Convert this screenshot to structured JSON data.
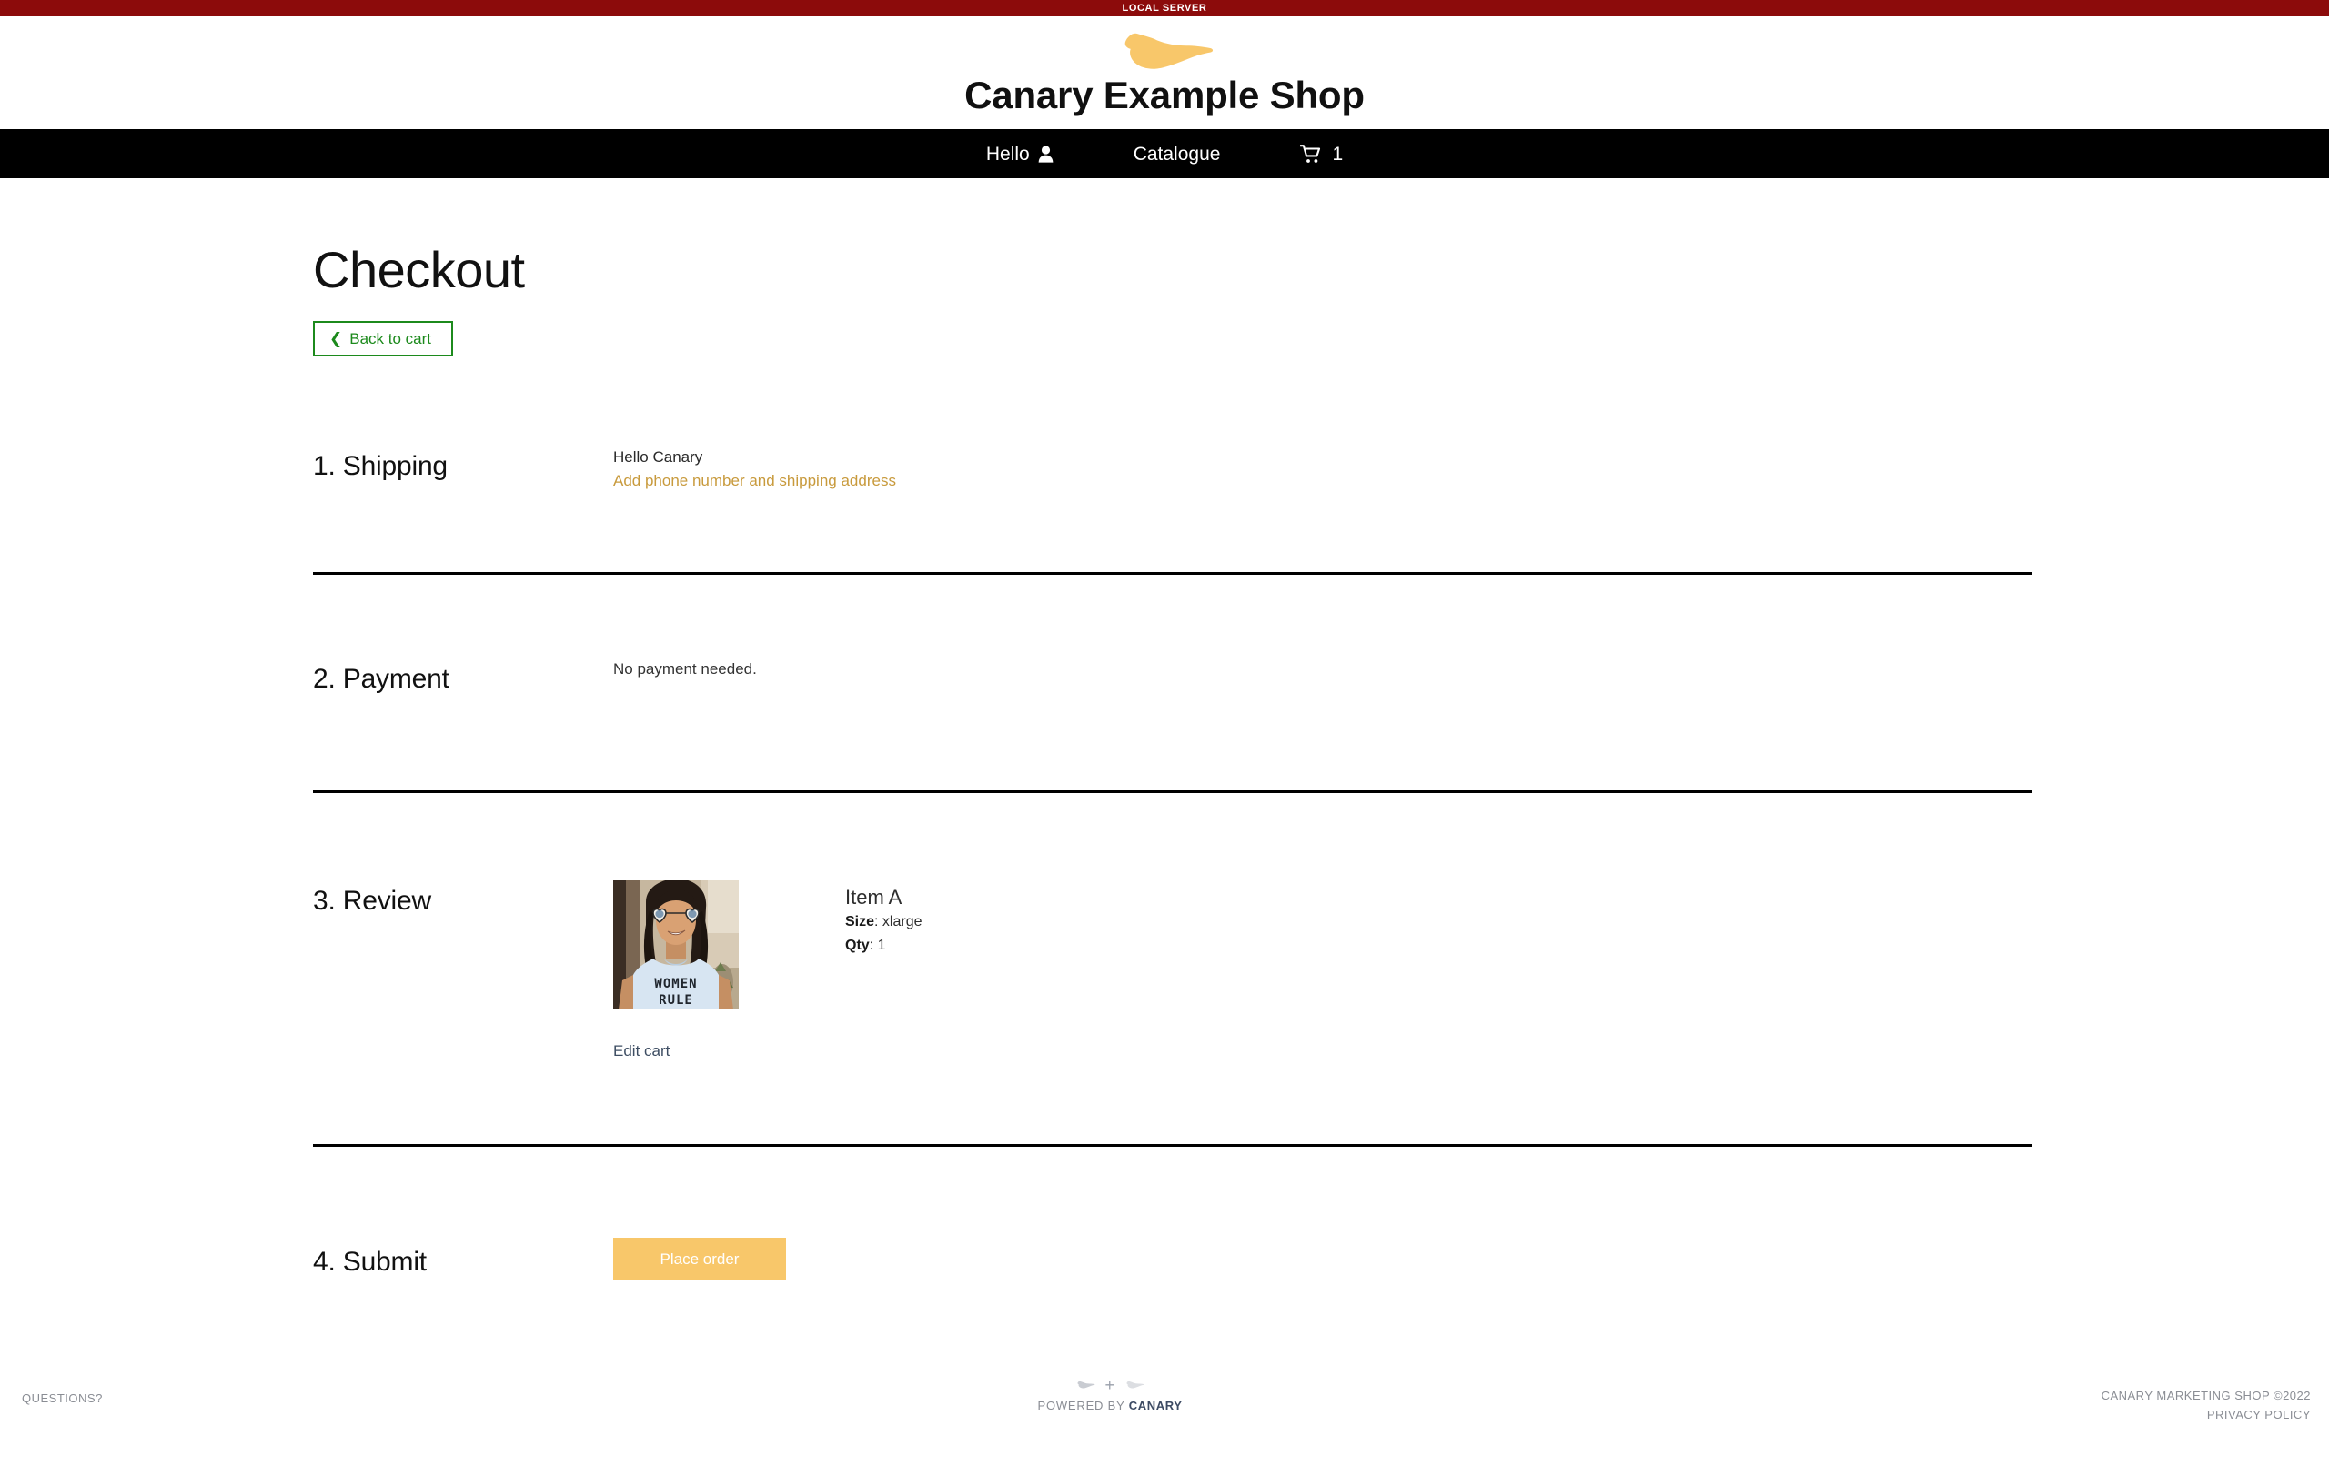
{
  "env_banner": {
    "label": "LOCAL SERVER",
    "color": "#8C0B0B"
  },
  "brand": {
    "title": "Canary Example Shop",
    "logo_icon": "canary-bird-icon",
    "logo_color": "#F8C76A"
  },
  "nav": {
    "items": [
      {
        "label": "Hello",
        "icon": "user-icon"
      },
      {
        "label": "Catalogue",
        "icon": ""
      },
      {
        "label": "",
        "icon": "shopping-cart-icon",
        "count": "1"
      }
    ]
  },
  "page": {
    "title": "Checkout",
    "back_button": {
      "label": "Back to cart",
      "icon": "chevron-left-icon",
      "color": "#1C8A1C"
    }
  },
  "sections": {
    "shipping": {
      "heading": "1. Shipping",
      "greeting": "Hello Canary",
      "address_link": "Add phone number and shipping address",
      "link_color": "#C89A3C"
    },
    "payment": {
      "heading": "2. Payment",
      "note": "No payment needed."
    },
    "review": {
      "heading": "3. Review",
      "product_image_alt": "Woman wearing WOMEN RULE t-shirt and heart sunglasses",
      "product_shirt_text_line1": "WOMEN",
      "product_shirt_text_line2": "RULE",
      "edit_cart_link": "Edit cart",
      "item_name": "Item A",
      "size_label": "Size",
      "size_value": "xlarge",
      "qty_label": "Qty",
      "qty_value": "1"
    },
    "submit": {
      "heading": "4. Submit",
      "place_order_label": "Place order",
      "button_color": "#F8C76A"
    }
  },
  "footer": {
    "questions": "QUESTIONS?",
    "powered_prefix": "POWERED BY",
    "powered_brand": "CANARY",
    "plus": "+",
    "copyright": "CANARY MARKETING SHOP ©2022",
    "privacy": "PRIVACY POLICY"
  }
}
